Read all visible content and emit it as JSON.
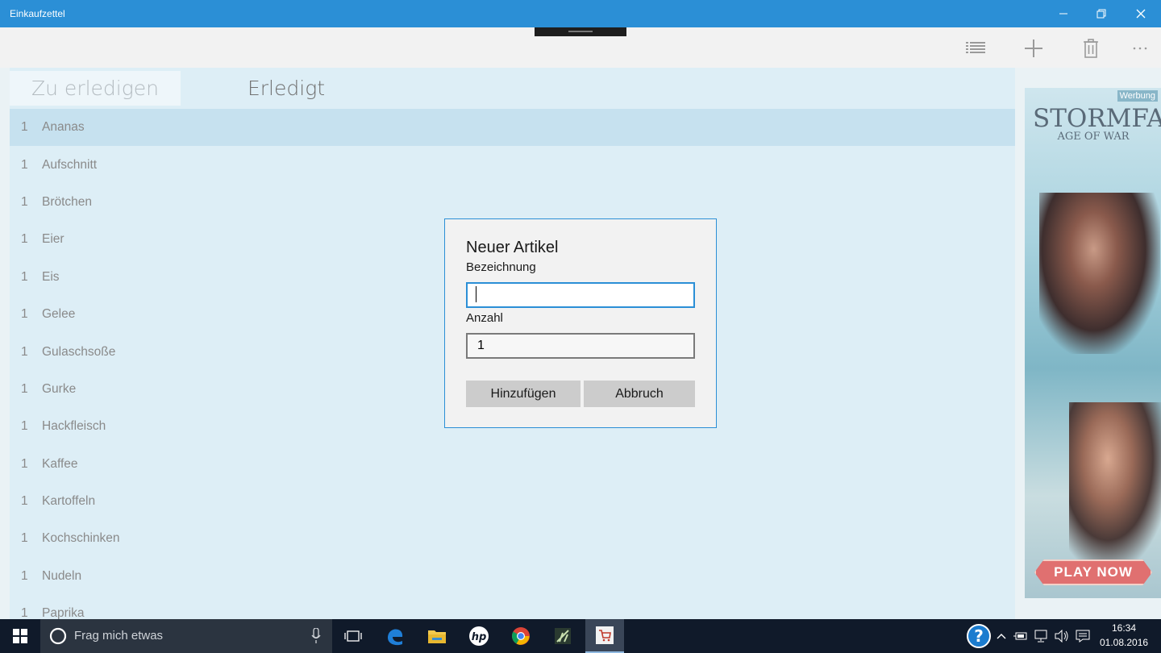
{
  "window": {
    "title": "Einkaufzettel"
  },
  "tabs": [
    {
      "label": "Zu erledigen",
      "active": true
    },
    {
      "label": "Erledigt",
      "active": false
    }
  ],
  "items": [
    {
      "qty": "1",
      "name": "Ananas",
      "selected": true
    },
    {
      "qty": "1",
      "name": "Aufschnitt"
    },
    {
      "qty": "1",
      "name": "Brötchen"
    },
    {
      "qty": "1",
      "name": "Eier"
    },
    {
      "qty": "1",
      "name": "Eis"
    },
    {
      "qty": "1",
      "name": "Gelee"
    },
    {
      "qty": "1",
      "name": "Gulaschsoße"
    },
    {
      "qty": "1",
      "name": "Gurke"
    },
    {
      "qty": "1",
      "name": "Hackfleisch"
    },
    {
      "qty": "1",
      "name": "Kaffee"
    },
    {
      "qty": "1",
      "name": "Kartoffeln"
    },
    {
      "qty": "1",
      "name": "Kochschinken"
    },
    {
      "qty": "1",
      "name": "Nudeln"
    },
    {
      "qty": "1",
      "name": "Paprika"
    }
  ],
  "dialog": {
    "title": "Neuer Artikel",
    "name_label": "Bezeichnung",
    "name_value": "",
    "count_label": "Anzahl",
    "count_value": "1",
    "add_label": "Hinzufügen",
    "cancel_label": "Abbruch"
  },
  "ad": {
    "label": "Werbung",
    "logo_line1": "STORMFALL",
    "logo_line2": "AGE OF WAR",
    "cta": "PLAY NOW"
  },
  "taskbar": {
    "search_placeholder": "Frag mich etwas",
    "time": "16:34",
    "date": "01.08.2016"
  },
  "colors": {
    "accent": "#2b8fd6",
    "list_background": "#ddeef6",
    "selected_row": "#c6e1ef",
    "taskbar": "#101a2a"
  }
}
